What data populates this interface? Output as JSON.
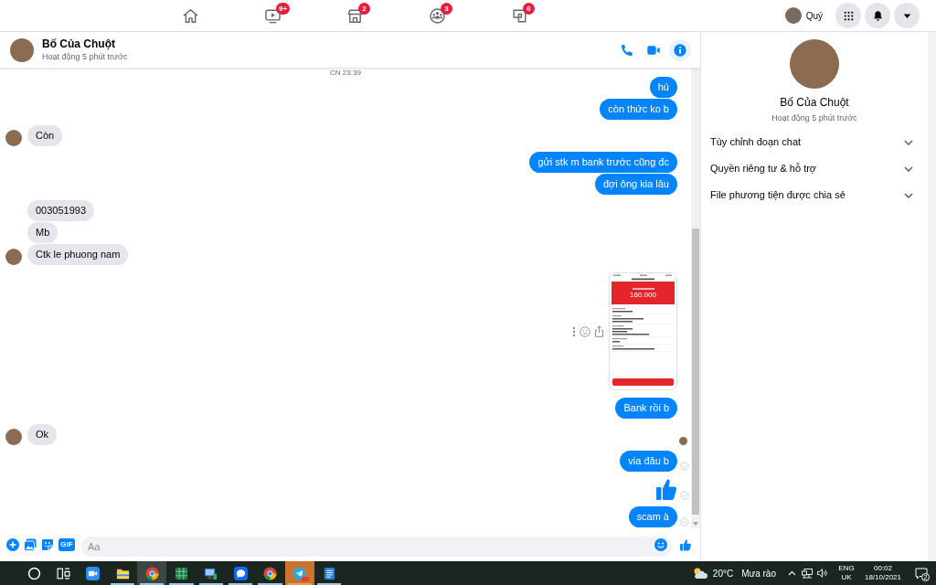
{
  "top_nav": {
    "tabs": [
      {
        "kind": "home"
      },
      {
        "kind": "watch",
        "badge": "9+"
      },
      {
        "kind": "marketplace",
        "badge": "2"
      },
      {
        "kind": "groups",
        "badge": "3"
      },
      {
        "kind": "gaming",
        "badge": "6"
      }
    ],
    "profile": {
      "name": "Quý"
    },
    "buttons": [
      {
        "kind": "menu"
      },
      {
        "kind": "notifications"
      },
      {
        "kind": "account"
      }
    ]
  },
  "chat": {
    "contact": {
      "name": "Bố Của Chuột",
      "status": "Hoạt động 5 phút trước"
    },
    "actions": [
      {
        "kind": "call",
        "selected": false
      },
      {
        "kind": "video",
        "selected": false
      },
      {
        "kind": "info",
        "selected": true
      }
    ],
    "messages": [
      {
        "kind": "timestamp",
        "text": "CN 23:39"
      },
      {
        "kind": "text",
        "outgoing": true,
        "text": "hú"
      },
      {
        "kind": "text",
        "outgoing": true,
        "text": "còn thức ko b"
      },
      {
        "kind": "text",
        "outgoing": false,
        "text": "Còn",
        "avatar": true
      },
      {
        "kind": "text",
        "outgoing": true,
        "text": "gửi stk m bank trước cũng đc"
      },
      {
        "kind": "text",
        "outgoing": true,
        "text": "đợi ông kia lâu"
      },
      {
        "kind": "text",
        "outgoing": false,
        "text": "003051993",
        "avatar": false
      },
      {
        "kind": "text",
        "outgoing": false,
        "text": "Mb",
        "avatar": false
      },
      {
        "kind": "text",
        "outgoing": false,
        "text": "Ctk le phuong nam",
        "avatar": true
      },
      {
        "kind": "image",
        "outgoing": true,
        "amount": "160.000",
        "hovered": true
      },
      {
        "kind": "text",
        "outgoing": true,
        "text": "Bank rồi b"
      },
      {
        "kind": "text",
        "outgoing": false,
        "text": "Ok",
        "avatar": true
      },
      {
        "kind": "seen"
      },
      {
        "kind": "text",
        "outgoing": true,
        "text": "via đâu b",
        "sent": true
      },
      {
        "kind": "like",
        "outgoing": true,
        "sent": true
      },
      {
        "kind": "text",
        "outgoing": true,
        "text": "scam à",
        "sent": true
      }
    ],
    "composer": {
      "tools": [
        {
          "kind": "add"
        },
        {
          "kind": "photo"
        },
        {
          "kind": "sticker"
        },
        {
          "kind": "gif",
          "label": "GIF"
        }
      ],
      "placeholder": "Aa"
    }
  },
  "info_panel": {
    "name": "Bố Của Chuột",
    "status": "Hoạt động 5 phút trước",
    "sections": [
      {
        "label": "Tùy chỉnh đoạn chat",
        "expanded": false
      },
      {
        "label": "Quyền riêng tư & hỗ trợ",
        "expanded": false
      },
      {
        "label": "File phương tiện được chia sẻ",
        "expanded": false
      }
    ]
  },
  "taskbar": {
    "buttons": [
      {
        "kind": "search"
      },
      {
        "kind": "task_view"
      }
    ],
    "apps": [
      {
        "kind": "zoom",
        "running": false,
        "selected": false,
        "flashing": false,
        "notified": false
      },
      {
        "kind": "explorer",
        "running": true,
        "selected": false,
        "flashing": false,
        "notified": false
      },
      {
        "kind": "chrome",
        "running": true,
        "selected": true,
        "flashing": false,
        "notified": false
      },
      {
        "kind": "excel",
        "running": true,
        "selected": false,
        "flashing": false,
        "notified": false
      },
      {
        "kind": "remote",
        "running": true,
        "selected": false,
        "flashing": false,
        "notified": false
      },
      {
        "kind": "zalo",
        "running": true,
        "selected": false,
        "flashing": false,
        "notified": false
      },
      {
        "kind": "chrome",
        "running": true,
        "selected": false,
        "flashing": false,
        "notified": false
      },
      {
        "kind": "telegram",
        "running": true,
        "selected": false,
        "flashing": true,
        "notified": true
      },
      {
        "kind": "word",
        "running": true,
        "selected": false,
        "flashing": false,
        "notified": false
      }
    ],
    "weather": {
      "temperature": "20°C",
      "condition": "Mưa rào"
    },
    "tray": [
      {
        "kind": "chevron"
      },
      {
        "kind": "network"
      },
      {
        "kind": "volume"
      }
    ],
    "language": {
      "code": "ENG",
      "layout": "UK"
    },
    "clock": {
      "time": "00:02",
      "date": "18/10/2021"
    },
    "notifications": {
      "count": "2"
    }
  }
}
